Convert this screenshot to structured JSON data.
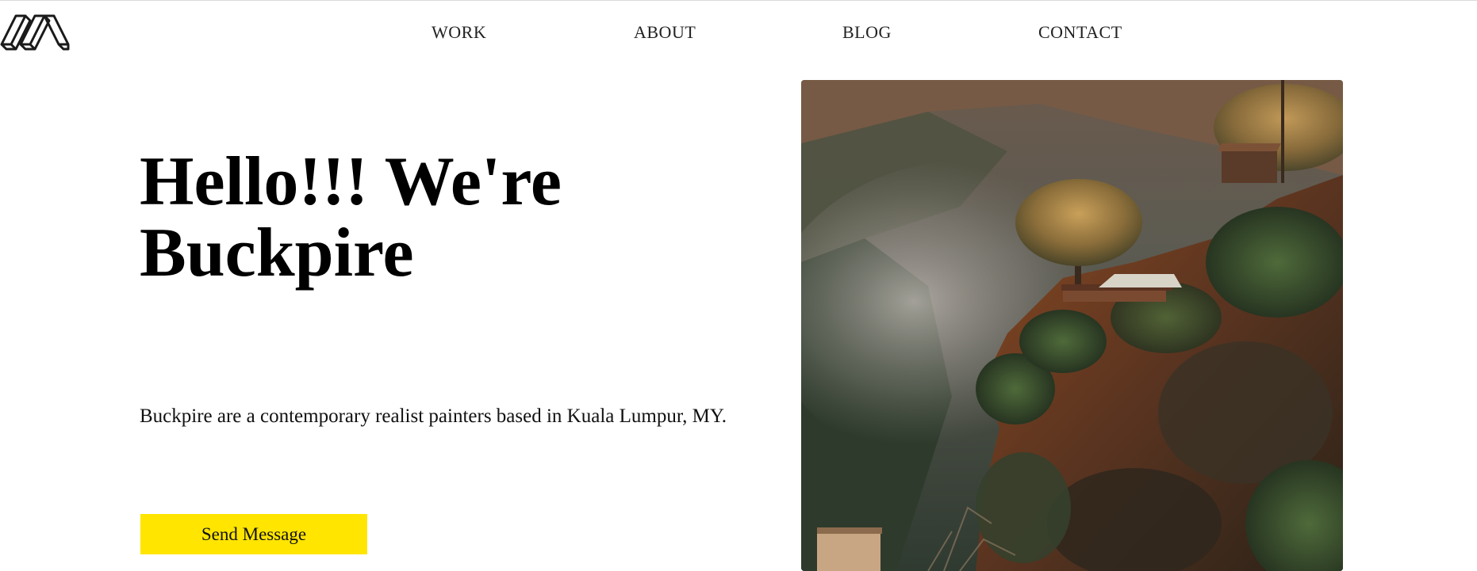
{
  "brand": {
    "logo_icon": "buckpire-logo-icon"
  },
  "nav": {
    "items": [
      {
        "label": "WORK"
      },
      {
        "label": "ABOUT"
      },
      {
        "label": "BLOG"
      },
      {
        "label": "CONTACT"
      }
    ]
  },
  "hero": {
    "title_line1": "Hello!!! We're",
    "title_line2": "Buckpire",
    "description": "Buckpire are a contemporary realist painters based in Kuala Lumpur, MY.",
    "button_label": "Send Message",
    "button_color": "#ffe500",
    "image_subject": "misty-cliffside-landscape-photo"
  }
}
